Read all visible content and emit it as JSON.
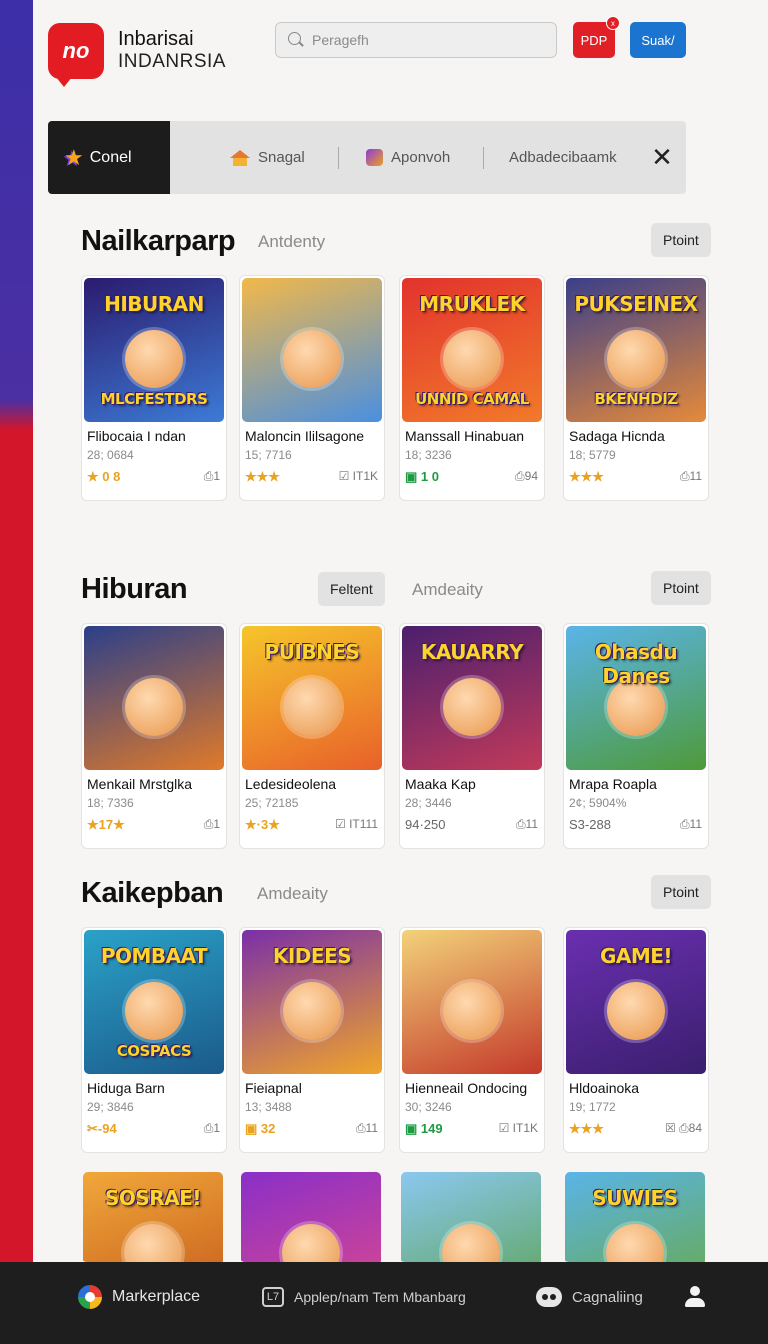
{
  "header": {
    "logo_text": "no",
    "brand_line1": "Inbarisai",
    "brand_line2": "INDANRSIA",
    "search_placeholder": "Peragefh",
    "pdp_label": "PDP",
    "pdp_badge": "x",
    "suak_label": "Suak/"
  },
  "tabs": {
    "active_label": "Conel",
    "items": [
      {
        "label": "Snagal",
        "icon": "house-icon"
      },
      {
        "label": "Aponvoh",
        "icon": "app-icon"
      },
      {
        "label": "Adbadecibaamk",
        "icon": ""
      }
    ],
    "close_glyph": "✕"
  },
  "sections": [
    {
      "title": "Nailkarparp",
      "subtitle": "Antdenty",
      "filter_label": "",
      "action_label": "Ptoint",
      "cards": [
        {
          "image_text": "HIBURAN",
          "image_sub": "MLCFESTDRS",
          "name": "Flibocaia I ndan",
          "count": "28; 0684",
          "rating": "★ 0 8",
          "meta": "⎙1",
          "bg": [
            "#2b1b6e",
            "#3c7bd6"
          ]
        },
        {
          "image_text": "",
          "image_sub": "",
          "name": "Maloncin Ililsagone",
          "count": "15; 7716",
          "rating": "★★★",
          "meta": "☑ IT1K",
          "bg": [
            "#f2b84a",
            "#4a8fe0"
          ]
        },
        {
          "image_text": "MRUKLEK",
          "image_sub": "UNNID CAMAL",
          "name": "Manssall Hinabuan",
          "count": "18; 3236",
          "rating": "▣ 1 0",
          "rating_green": true,
          "meta": "⎙94",
          "bg": [
            "#e2332d",
            "#f27a2a"
          ]
        },
        {
          "image_text": "PUKSEINEX",
          "image_sub": "BKENHDIZ",
          "name": "Sadaga Hicnda",
          "count": "18; 5779",
          "rating": "★★★",
          "meta": "⎙11",
          "bg": [
            "#3a3f8a",
            "#e58a3a"
          ]
        }
      ]
    },
    {
      "title": "Hiburan",
      "subtitle": "Amdeaity",
      "filter_label": "Feltent",
      "action_label": "Ptoint",
      "cards": [
        {
          "image_text": "",
          "image_sub": "",
          "name": "Menkail Mrstglka",
          "count": "18; 7336",
          "rating": "★17★",
          "meta": "⎙1",
          "bg": [
            "#2b3f8a",
            "#e07a2a"
          ]
        },
        {
          "image_text": "PUIBNES",
          "image_sub": "",
          "name": "Ledesideolena",
          "count": "25; 72185",
          "rating": "★·3★",
          "meta": "☑ IT111",
          "bg": [
            "#f6c52b",
            "#e8612a"
          ]
        },
        {
          "image_text": "KAUARRY",
          "image_sub": "",
          "name": "Maaka Kap",
          "count": "28; 3446",
          "rating": "94·250",
          "meta": "⎙11",
          "rating_plain": true,
          "bg": [
            "#4a1f6e",
            "#c23a5a"
          ]
        },
        {
          "image_text": "Ohasdu Danes",
          "image_sub": "",
          "name": "Mrapa Roapla",
          "count": "2¢; 5904%",
          "rating": "S3-288",
          "meta": "⎙11",
          "rating_plain": true,
          "bg": [
            "#5ab4e8",
            "#4e9a3a"
          ]
        }
      ]
    },
    {
      "title": "Kaikepban",
      "subtitle": "Amdeaity",
      "filter_label": "",
      "action_label": "Ptoint",
      "cards": [
        {
          "image_text": "POMBAAT",
          "image_sub": "COSPACS",
          "name": "Hiduga Barn",
          "count": "29; 3846",
          "rating": "✂-94",
          "meta": "⎙1",
          "bg": [
            "#2aa2c8",
            "#1b5a8a"
          ]
        },
        {
          "image_text": "KIDEES",
          "image_sub": "",
          "name": "Fieiapnal",
          "count": "13; 3488",
          "rating": "▣ 32",
          "meta": "⎙11",
          "bg": [
            "#7a2fa8",
            "#f0a52a"
          ]
        },
        {
          "image_text": "",
          "image_sub": "",
          "name": "Hienneail Ondocing",
          "count": "30; 3246",
          "rating": "▣ 149",
          "rating_green": true,
          "meta": "☑ IT1K",
          "bg": [
            "#f2d27a",
            "#c43a2a"
          ]
        },
        {
          "image_text": "GAME!",
          "image_sub": "",
          "name": "Hldoainoka",
          "count": "19; 1772",
          "rating": "★★★",
          "meta": "☒ ⎙84",
          "bg": [
            "#6a2fb0",
            "#3a1f6e"
          ]
        }
      ]
    },
    {
      "title": "",
      "subtitle": "",
      "filter_label": "",
      "action_label": "",
      "cards": [
        {
          "image_text": "SOSRAE!",
          "image_sub": "",
          "name": "",
          "count": "",
          "rating": "",
          "meta": "",
          "bg": [
            "#f0a83a",
            "#c4561a"
          ]
        },
        {
          "image_text": "",
          "image_sub": "",
          "name": "",
          "count": "",
          "rating": "",
          "meta": "",
          "bg": [
            "#8a2fc8",
            "#e04a8a"
          ]
        },
        {
          "image_text": "",
          "image_sub": "",
          "name": "",
          "count": "",
          "rating": "",
          "meta": "",
          "bg": [
            "#8ac8f0",
            "#5aa04a"
          ]
        },
        {
          "image_text": "SUWIES",
          "image_sub": "",
          "name": "",
          "count": "",
          "rating": "",
          "meta": "",
          "bg": [
            "#5ab4e8",
            "#6aa83a"
          ]
        }
      ]
    }
  ],
  "bottom_nav": [
    {
      "label": "Markerplace",
      "icon": "marketplace-icon"
    },
    {
      "label": "Applep/nam Tem Mbanbarg",
      "icon": "calendar-icon"
    },
    {
      "label": "Cagnaliing",
      "icon": "gamepad-icon"
    },
    {
      "label": "",
      "icon": "user-icon"
    }
  ],
  "colors": {
    "brand_red": "#e31b23",
    "accent_blue": "#1a74d0",
    "stripe_purple": "#3c2fa8",
    "bottom_bar": "#1e1e1e"
  }
}
